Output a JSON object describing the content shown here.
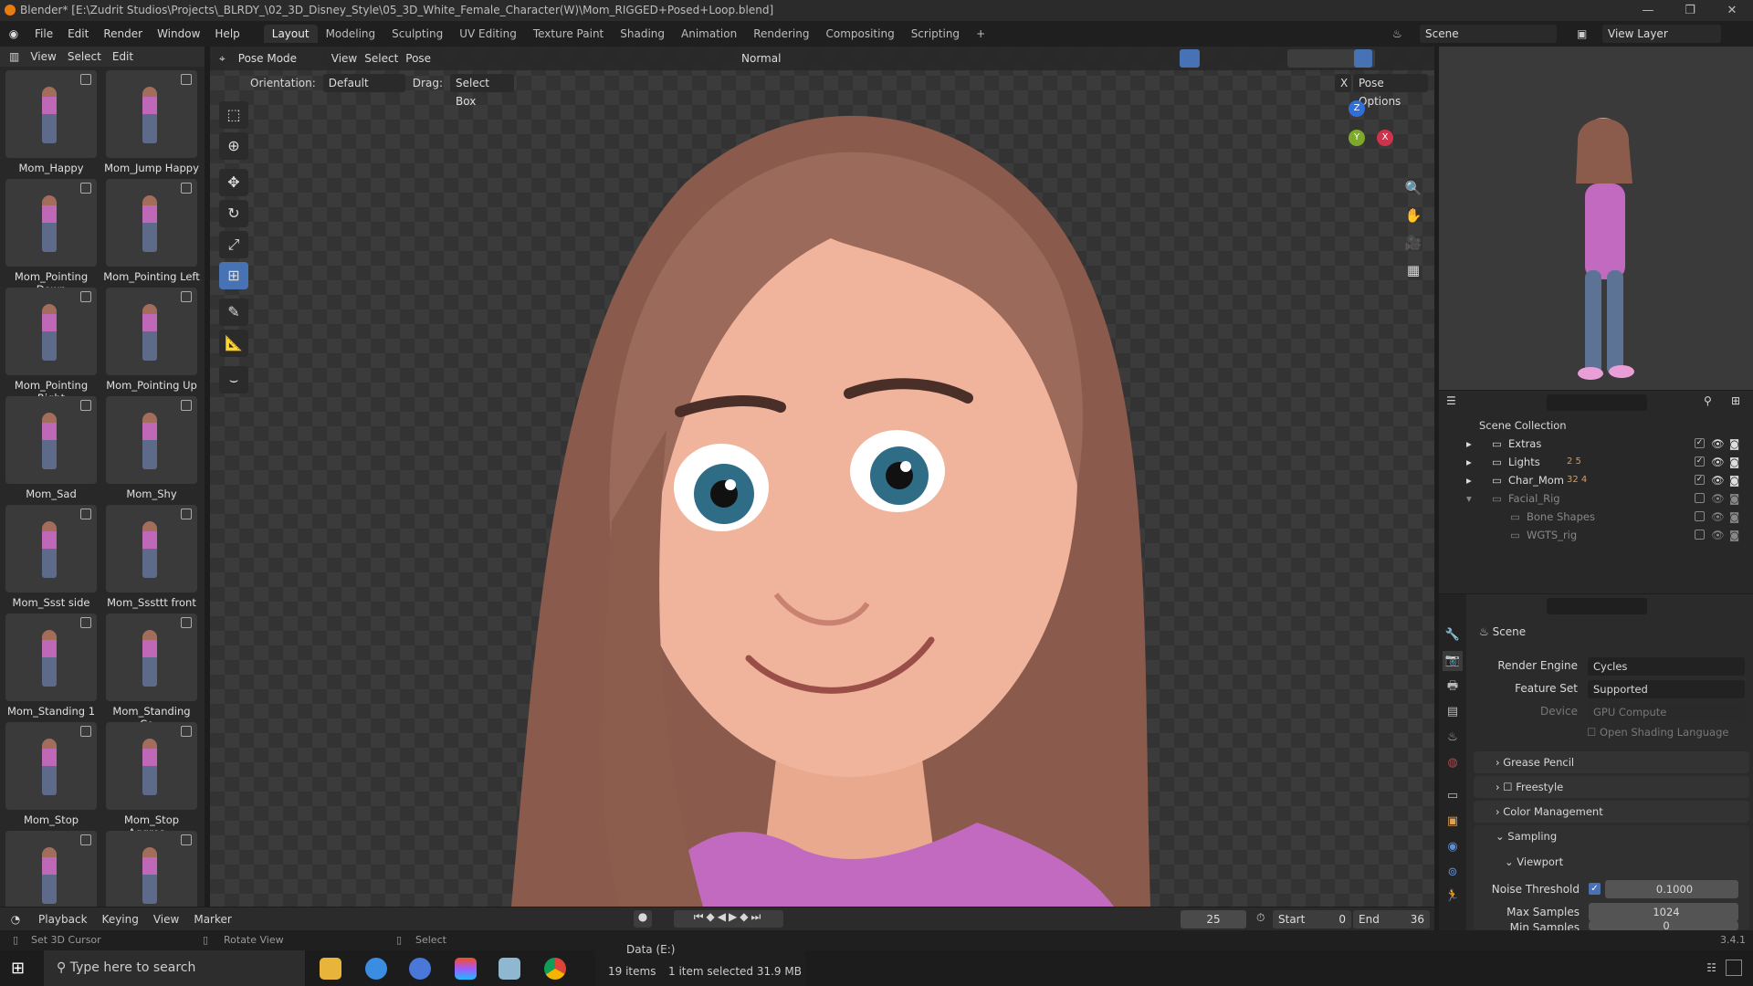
{
  "window": {
    "title": "Blender* [E:\\Zudrit Studios\\Projects\\_BLRDY_\\02_3D_Disney_Style\\05_3D_White_Female_Character(W)\\Mom_RIGGED+Posed+Loop.blend]",
    "minimize": "—",
    "maximize": "❐",
    "close": "✕"
  },
  "menu": [
    "File",
    "Edit",
    "Render",
    "Window",
    "Help"
  ],
  "workspaces": [
    "Layout",
    "Modeling",
    "Sculpting",
    "UV Editing",
    "Texture Paint",
    "Shading",
    "Animation",
    "Rendering",
    "Compositing",
    "Scripting",
    "+"
  ],
  "active_workspace": "Layout",
  "scene": {
    "name": "Scene",
    "view_layer": "View Layer"
  },
  "asset_browser": {
    "menus": [
      "View",
      "Select",
      "Edit"
    ],
    "items": [
      "Mom_Happy",
      "Mom_Jump Happy",
      "Mom_Pointing Down",
      "Mom_Pointing Left",
      "Mom_Pointing Right",
      "Mom_Pointing Up",
      "Mom_Sad",
      "Mom_Shy",
      "Mom_Ssst side",
      "Mom_Sssttt front",
      "Mom_Standing 1",
      "Mom_Standing Co...",
      "Mom_Stop",
      "Mom_Stop Aggres...",
      "",
      ""
    ]
  },
  "viewport": {
    "mode": "Pose Mode",
    "menus": [
      "View",
      "Select",
      "Pose"
    ],
    "transform_orientation": "Normal",
    "orientation_label": "Orientation:",
    "orientation_value": "Default",
    "drag_label": "Drag:",
    "drag_value": "Select Box",
    "pose_options": "Pose Options",
    "x_mirror": "X",
    "gizmo": {
      "z": "Z",
      "y": "Y",
      "x": "X"
    }
  },
  "outliner": {
    "root": "Scene Collection",
    "rows": [
      {
        "name": "Extras",
        "badges": "",
        "checked": true
      },
      {
        "name": "Lights",
        "badges": "2 5",
        "checked": true
      },
      {
        "name": "Char_Mom",
        "badges": "32 4",
        "checked": true
      },
      {
        "name": "Facial_Rig",
        "badges": "",
        "checked": false
      },
      {
        "name": "Bone Shapes",
        "badges": "",
        "checked": false
      },
      {
        "name": "WGTS_rig",
        "badges": "",
        "checked": false
      }
    ]
  },
  "properties": {
    "context": "Scene",
    "render_engine_label": "Render Engine",
    "render_engine": "Cycles",
    "feature_set_label": "Feature Set",
    "feature_set": "Supported",
    "device_label": "Device",
    "device": "GPU Compute",
    "osl": "Open Shading Language",
    "panels": [
      "Grease Pencil",
      "Freestyle",
      "Color Management",
      "Sampling"
    ],
    "viewport_sub": "Viewport",
    "noise_threshold_label": "Noise Threshold",
    "noise_threshold": "0.1000",
    "max_samples_label": "Max Samples",
    "max_samples": "1024",
    "min_samples_label": "Min Samples",
    "min_samples": "0"
  },
  "timeline": {
    "menus": [
      "Playback",
      "Keying",
      "View",
      "Marker"
    ],
    "current_frame": "25",
    "start_label": "Start",
    "start": "0",
    "end_label": "End",
    "end": "36"
  },
  "status": {
    "left": "Set 3D Cursor",
    "middle": "Rotate View",
    "right": "Select",
    "version": "3.4.1"
  },
  "taskbar": {
    "search_placeholder": "Type here to search"
  },
  "explorer_popup": {
    "drive": "Data (E:)",
    "items": "19 items",
    "selected": "1 item selected  31.9 MB"
  },
  "colors": {
    "accent": "#4772b3",
    "blender_orange": "#e87d0d",
    "shirt": "#c26ac0"
  }
}
